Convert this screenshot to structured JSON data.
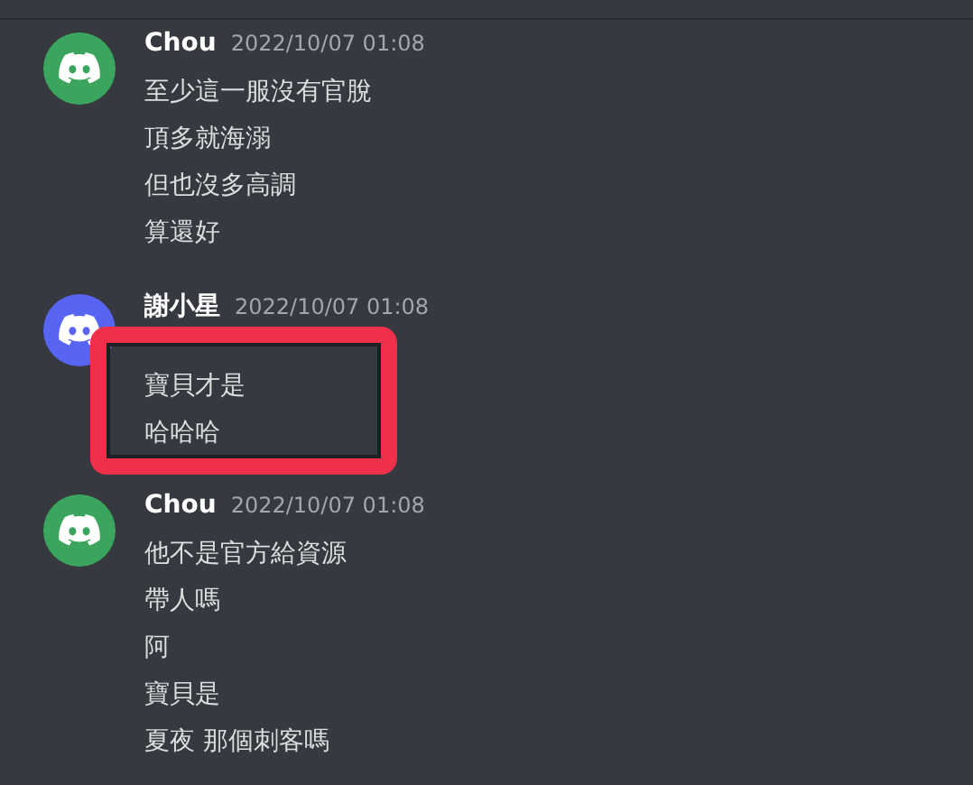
{
  "messages": [
    {
      "author": "Chou",
      "color": "#3ba55d",
      "timestamp": "2022/10/07 01:08",
      "highlighted": false,
      "lines": [
        "至少這一服沒有官脫",
        "頂多就海溺",
        "但也沒多高調",
        "算還好"
      ]
    },
    {
      "author": "謝小星",
      "color": "#5865f2",
      "timestamp": "2022/10/07 01:08",
      "highlighted": true,
      "lines": [
        "寶貝才是",
        "哈哈哈"
      ]
    },
    {
      "author": "Chou",
      "color": "#3ba55d",
      "timestamp": "2022/10/07 01:08",
      "highlighted": false,
      "lines": [
        "他不是官方給資源",
        "帶人嗎",
        "阿",
        "寶貝是",
        "夏夜 那個刺客嗎"
      ]
    }
  ]
}
